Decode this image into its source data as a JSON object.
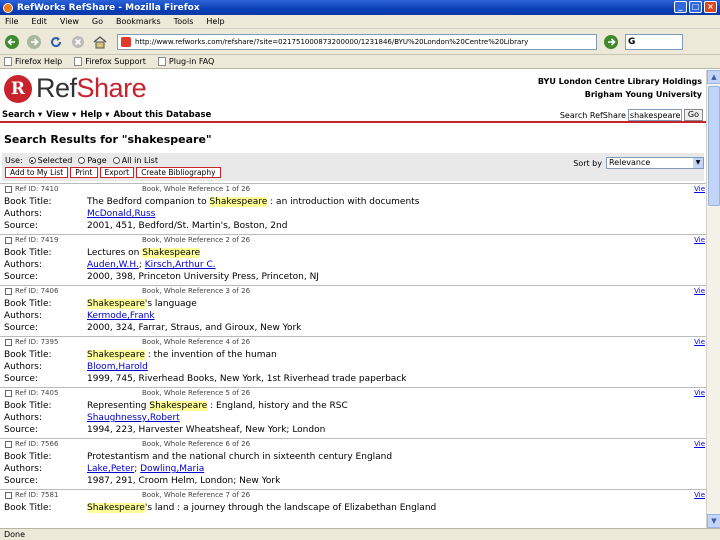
{
  "window": {
    "title": "RefWorks RefShare - Mozilla Firefox"
  },
  "menu": {
    "items": [
      "File",
      "Edit",
      "View",
      "Go",
      "Bookmarks",
      "Tools",
      "Help"
    ]
  },
  "nav": {
    "url": "http://www.refworks.com/refshare/?site=021751000873200000/1231846/BYU%20London%20Centre%20Library",
    "search_value": "G"
  },
  "bookmarks": [
    "Firefox Help",
    "Firefox Support",
    "Plug-in FAQ"
  ],
  "refshare": {
    "logo_ref": "Ref",
    "logo_share": "Share",
    "library_line1": "BYU London Centre Library Holdings",
    "library_line2": "Brigham Young University",
    "menu": [
      "Search ▾",
      "View ▾",
      "Help ▾",
      "About this Database"
    ],
    "search_label": "Search RefShare",
    "search_value": "shakespeare",
    "search_button": "Go",
    "results_title": "Search Results for \"shakespeare\"",
    "use_label": "Use:",
    "use_options": [
      "Selected",
      "Page",
      "All in List"
    ],
    "buttons": [
      "Add to My List",
      "Print",
      "Export",
      "Create Bibliography"
    ],
    "sort_label": "Sort by",
    "sort_value": "Relevance",
    "more_label": "Vie"
  },
  "labels": {
    "title": "Book Title:",
    "authors": "Authors:",
    "source": "Source:"
  },
  "records": [
    {
      "ref_id": "Ref ID: 7410",
      "type": "Book, Whole Reference 1 of 26",
      "title_pre": "The Bedford companion to ",
      "title_hl": "Shakespeare",
      "title_post": " : an introduction with documents",
      "authors": [
        "McDonald,Russ"
      ],
      "source": "2001, 451, Bedford/St. Martin's, Boston, 2nd"
    },
    {
      "ref_id": "Ref ID: 7419",
      "type": "Book, Whole Reference 2 of 26",
      "title_pre": "Lectures on ",
      "title_hl": "Shakespeare",
      "title_post": "",
      "authors": [
        "Auden,W.H.",
        "Kirsch,Arthur C."
      ],
      "source": "2000, 398, Princeton University Press, Princeton, NJ"
    },
    {
      "ref_id": "Ref ID: 7406",
      "type": "Book, Whole Reference 3 of 26",
      "title_pre": "",
      "title_hl": "Shakespeare",
      "title_post": "'s language",
      "authors": [
        "Kermode,Frank"
      ],
      "source": "2000, 324, Farrar, Straus, and Giroux, New York"
    },
    {
      "ref_id": "Ref ID: 7395",
      "type": "Book, Whole Reference 4 of 26",
      "title_pre": "",
      "title_hl": "Shakespeare",
      "title_post": " : the invention of the human",
      "authors": [
        "Bloom,Harold"
      ],
      "source": "1999, 745, Riverhead Books, New York, 1st Riverhead trade paperback"
    },
    {
      "ref_id": "Ref ID: 7405",
      "type": "Book, Whole Reference 5 of 26",
      "title_pre": "Representing ",
      "title_hl": "Shakespeare",
      "title_post": " : England, history and the RSC",
      "authors": [
        "Shaughnessy,Robert"
      ],
      "source": "1994, 223, Harvester Wheatsheaf, New York; London"
    },
    {
      "ref_id": "Ref ID: 7566",
      "type": "Book, Whole Reference 6 of 26",
      "title_pre": "Protestantism and the national church in sixteenth century England",
      "title_hl": "",
      "title_post": "",
      "authors": [
        "Lake,Peter",
        "Dowling,Maria"
      ],
      "source": "1987, 291, Croom Helm, London; New York"
    },
    {
      "ref_id": "Ref ID: 7581",
      "type": "Book, Whole Reference 7 of 26",
      "title_pre": "",
      "title_hl": "Shakespeare",
      "title_post": "'s land : a journey through the landscape of Elizabethan England",
      "authors": [],
      "source": ""
    }
  ],
  "status": "Done"
}
